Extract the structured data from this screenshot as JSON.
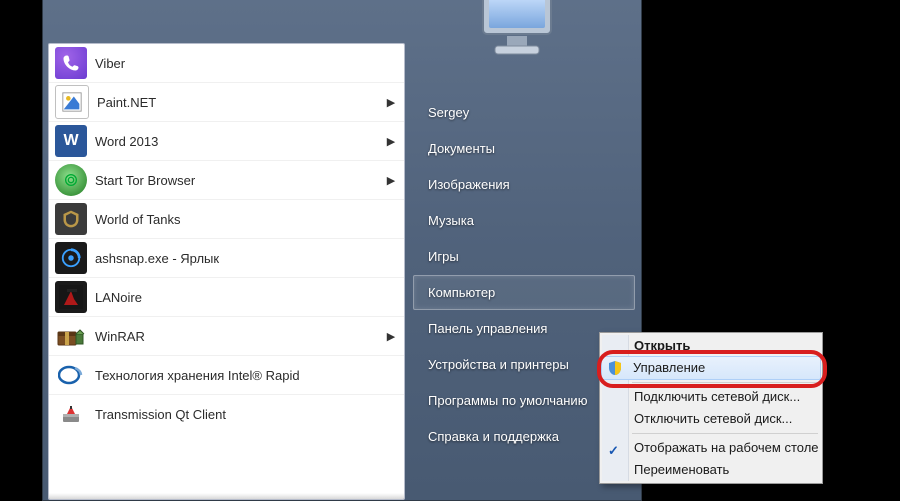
{
  "programs": [
    {
      "label": "Viber",
      "arrow": false,
      "icon": "viber"
    },
    {
      "label": "Paint.NET",
      "arrow": true,
      "icon": "paintnet"
    },
    {
      "label": "Word 2013",
      "arrow": true,
      "icon": "word"
    },
    {
      "label": "Start Tor Browser",
      "arrow": true,
      "icon": "tor"
    },
    {
      "label": "World of Tanks",
      "arrow": false,
      "icon": "wot"
    },
    {
      "label": "ashsnap.exe - Ярлык",
      "arrow": false,
      "icon": "ashsnap"
    },
    {
      "label": "LANoire",
      "arrow": false,
      "icon": "lanoire"
    },
    {
      "label": "WinRAR",
      "arrow": true,
      "icon": "winrar"
    },
    {
      "label": "Технология хранения Intel® Rapid",
      "arrow": false,
      "icon": "intelrapid"
    },
    {
      "label": "Transmission Qt Client",
      "arrow": false,
      "icon": "transmission"
    }
  ],
  "right": [
    {
      "label": "Sergey",
      "sel": false
    },
    {
      "label": "Документы",
      "sel": false
    },
    {
      "label": "Изображения",
      "sel": false
    },
    {
      "label": "Музыка",
      "sel": false
    },
    {
      "label": "Игры",
      "sel": false
    },
    {
      "label": "Компьютер",
      "sel": true
    },
    {
      "label": "Панель управления",
      "sel": false
    },
    {
      "label": "Устройства и принтеры",
      "sel": false
    },
    {
      "label": "Программы по умолчанию",
      "sel": false
    },
    {
      "label": "Справка и поддержка",
      "sel": false
    }
  ],
  "ctx": {
    "open": "Открыть",
    "manage": "Управление",
    "mapnet": "Подключить сетевой диск...",
    "unmapnet": "Отключить сетевой диск...",
    "showdesk": "Отображать на рабочем столе",
    "rename": "Переименовать"
  }
}
